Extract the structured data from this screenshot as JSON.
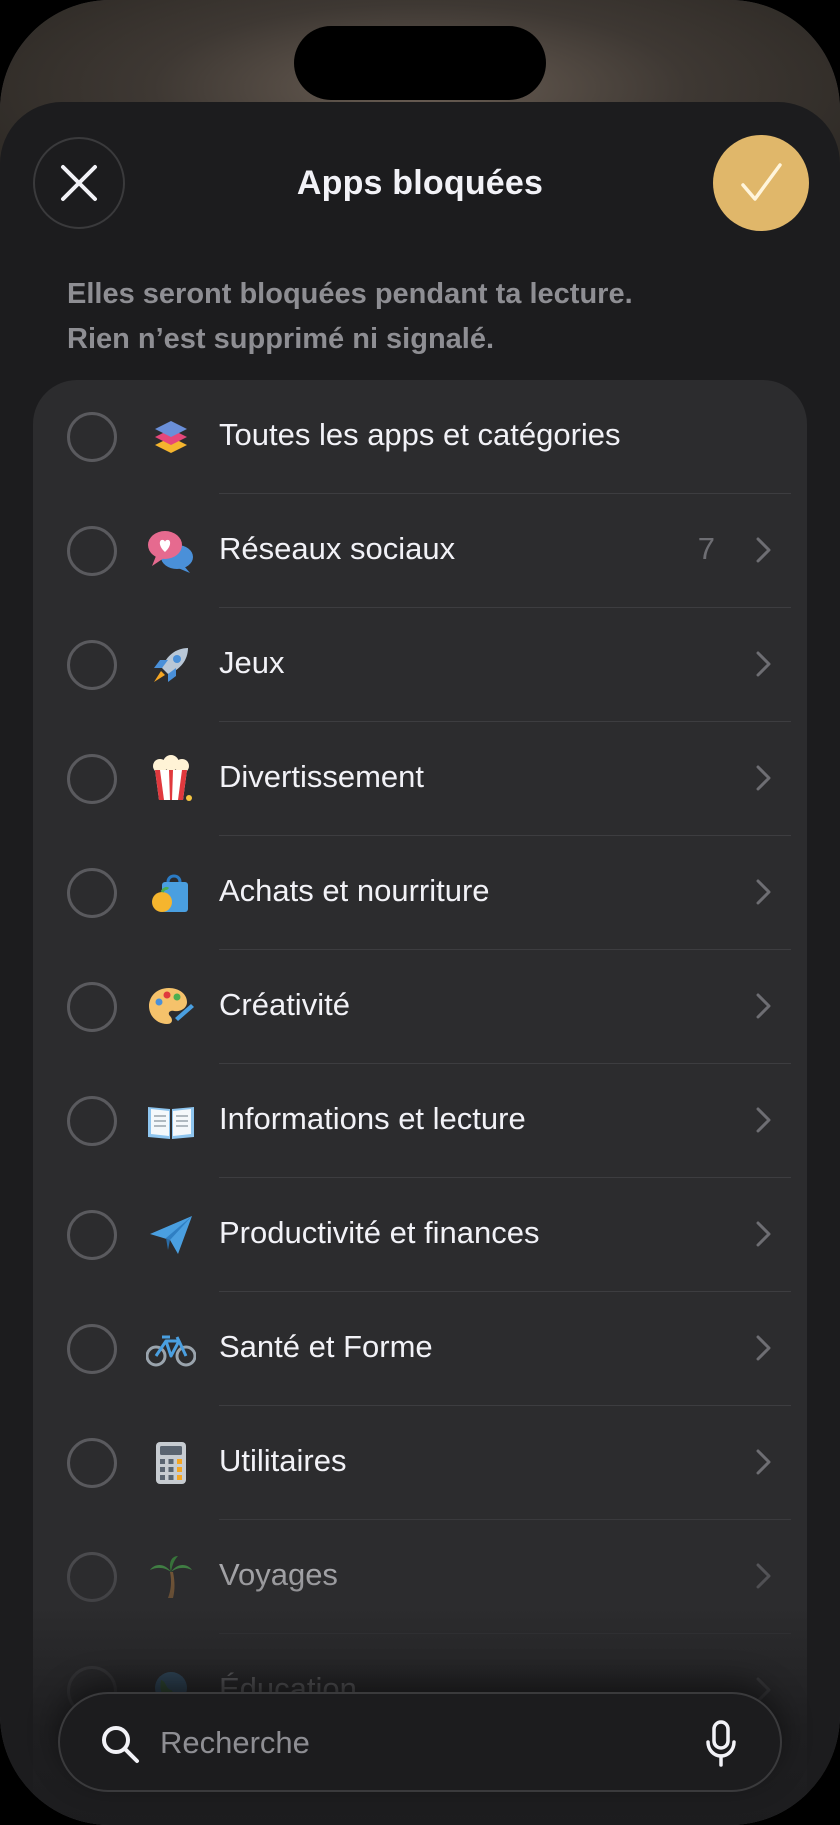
{
  "header": {
    "title": "Apps bloquées",
    "subtitle_line1": "Elles seront bloquées pendant ta lecture.",
    "subtitle_line2": "Rien n’est supprimé ni signalé."
  },
  "categories": [
    {
      "label": "Toutes les apps et catégories",
      "icon": "stack-layers-icon",
      "chevron": false
    },
    {
      "label": "Réseaux sociaux",
      "icon": "chat-bubbles-heart-icon",
      "count": "7",
      "chevron": true
    },
    {
      "label": "Jeux",
      "icon": "rocket-icon",
      "chevron": true
    },
    {
      "label": "Divertissement",
      "icon": "popcorn-icon",
      "chevron": true
    },
    {
      "label": "Achats et nourriture",
      "icon": "shopping-bag-icon",
      "chevron": true
    },
    {
      "label": "Créativité",
      "icon": "palette-icon",
      "chevron": true
    },
    {
      "label": "Informations et lecture",
      "icon": "open-book-icon",
      "chevron": true
    },
    {
      "label": "Productivité et finances",
      "icon": "paper-plane-icon",
      "chevron": true
    },
    {
      "label": "Santé et Forme",
      "icon": "bicycle-icon",
      "chevron": true
    },
    {
      "label": "Utilitaires",
      "icon": "calculator-icon",
      "chevron": true
    },
    {
      "label": "Voyages",
      "icon": "palm-tree-icon",
      "chevron": true
    },
    {
      "label": "Éducation",
      "icon": "globe-icon",
      "chevron": true
    }
  ],
  "search": {
    "placeholder": "Recherche"
  },
  "colors": {
    "accent": "#e0b76a",
    "sheet_background": "#1c1c1e",
    "list_background": "#2c2c2e"
  }
}
